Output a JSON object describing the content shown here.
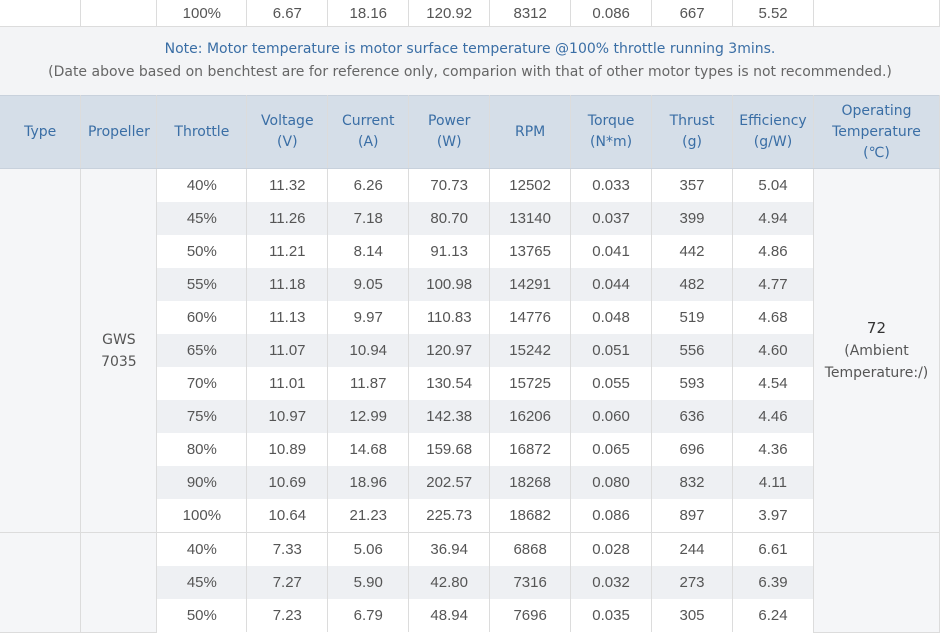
{
  "top_row": {
    "throttle": "100%",
    "voltage": "6.67",
    "current": "18.16",
    "power": "120.92",
    "rpm": "8312",
    "torque": "0.086",
    "thrust": "667",
    "efficiency": "5.52"
  },
  "note": {
    "line1": "Note: Motor temperature is motor surface temperature @100% throttle running 3mins.",
    "line2": "(Date above based on benchtest are for reference only, comparion with that of other motor types is not recommended.)"
  },
  "headers": {
    "type": "Type",
    "propeller": "Propeller",
    "throttle": "Throttle",
    "voltage": [
      "Voltage",
      "(V)"
    ],
    "current": [
      "Current",
      "(A)"
    ],
    "power": [
      "Power",
      "(W)"
    ],
    "rpm": "RPM",
    "torque": [
      "Torque",
      "(N*m)"
    ],
    "thrust": [
      "Thrust",
      "(g)"
    ],
    "efficiency": [
      "Efficiency",
      "(g/W)"
    ],
    "operating_temperature": [
      "Operating",
      "Temperature",
      "(℃)"
    ]
  },
  "group1": {
    "propeller": [
      "GWS",
      "7035"
    ],
    "operating_temperature": [
      "72",
      "(Ambient",
      "Temperature:/)"
    ],
    "rows": [
      [
        "40%",
        "11.32",
        "6.26",
        "70.73",
        "12502",
        "0.033",
        "357",
        "5.04"
      ],
      [
        "45%",
        "11.26",
        "7.18",
        "80.70",
        "13140",
        "0.037",
        "399",
        "4.94"
      ],
      [
        "50%",
        "11.21",
        "8.14",
        "91.13",
        "13765",
        "0.041",
        "442",
        "4.86"
      ],
      [
        "55%",
        "11.18",
        "9.05",
        "100.98",
        "14291",
        "0.044",
        "482",
        "4.77"
      ],
      [
        "60%",
        "11.13",
        "9.97",
        "110.83",
        "14776",
        "0.048",
        "519",
        "4.68"
      ],
      [
        "65%",
        "11.07",
        "10.94",
        "120.97",
        "15242",
        "0.051",
        "556",
        "4.60"
      ],
      [
        "70%",
        "11.01",
        "11.87",
        "130.54",
        "15725",
        "0.055",
        "593",
        "4.54"
      ],
      [
        "75%",
        "10.97",
        "12.99",
        "142.38",
        "16206",
        "0.060",
        "636",
        "4.46"
      ],
      [
        "80%",
        "10.89",
        "14.68",
        "159.68",
        "16872",
        "0.065",
        "696",
        "4.36"
      ],
      [
        "90%",
        "10.69",
        "18.96",
        "202.57",
        "18268",
        "0.080",
        "832",
        "4.11"
      ],
      [
        "100%",
        "10.64",
        "21.23",
        "225.73",
        "18682",
        "0.086",
        "897",
        "3.97"
      ]
    ]
  },
  "group2": {
    "rows": [
      [
        "40%",
        "7.33",
        "5.06",
        "36.94",
        "6868",
        "0.028",
        "244",
        "6.61"
      ],
      [
        "45%",
        "7.27",
        "5.90",
        "42.80",
        "7316",
        "0.032",
        "273",
        "6.39"
      ],
      [
        "50%",
        "7.23",
        "6.79",
        "48.94",
        "7696",
        "0.035",
        "305",
        "6.24"
      ]
    ]
  }
}
